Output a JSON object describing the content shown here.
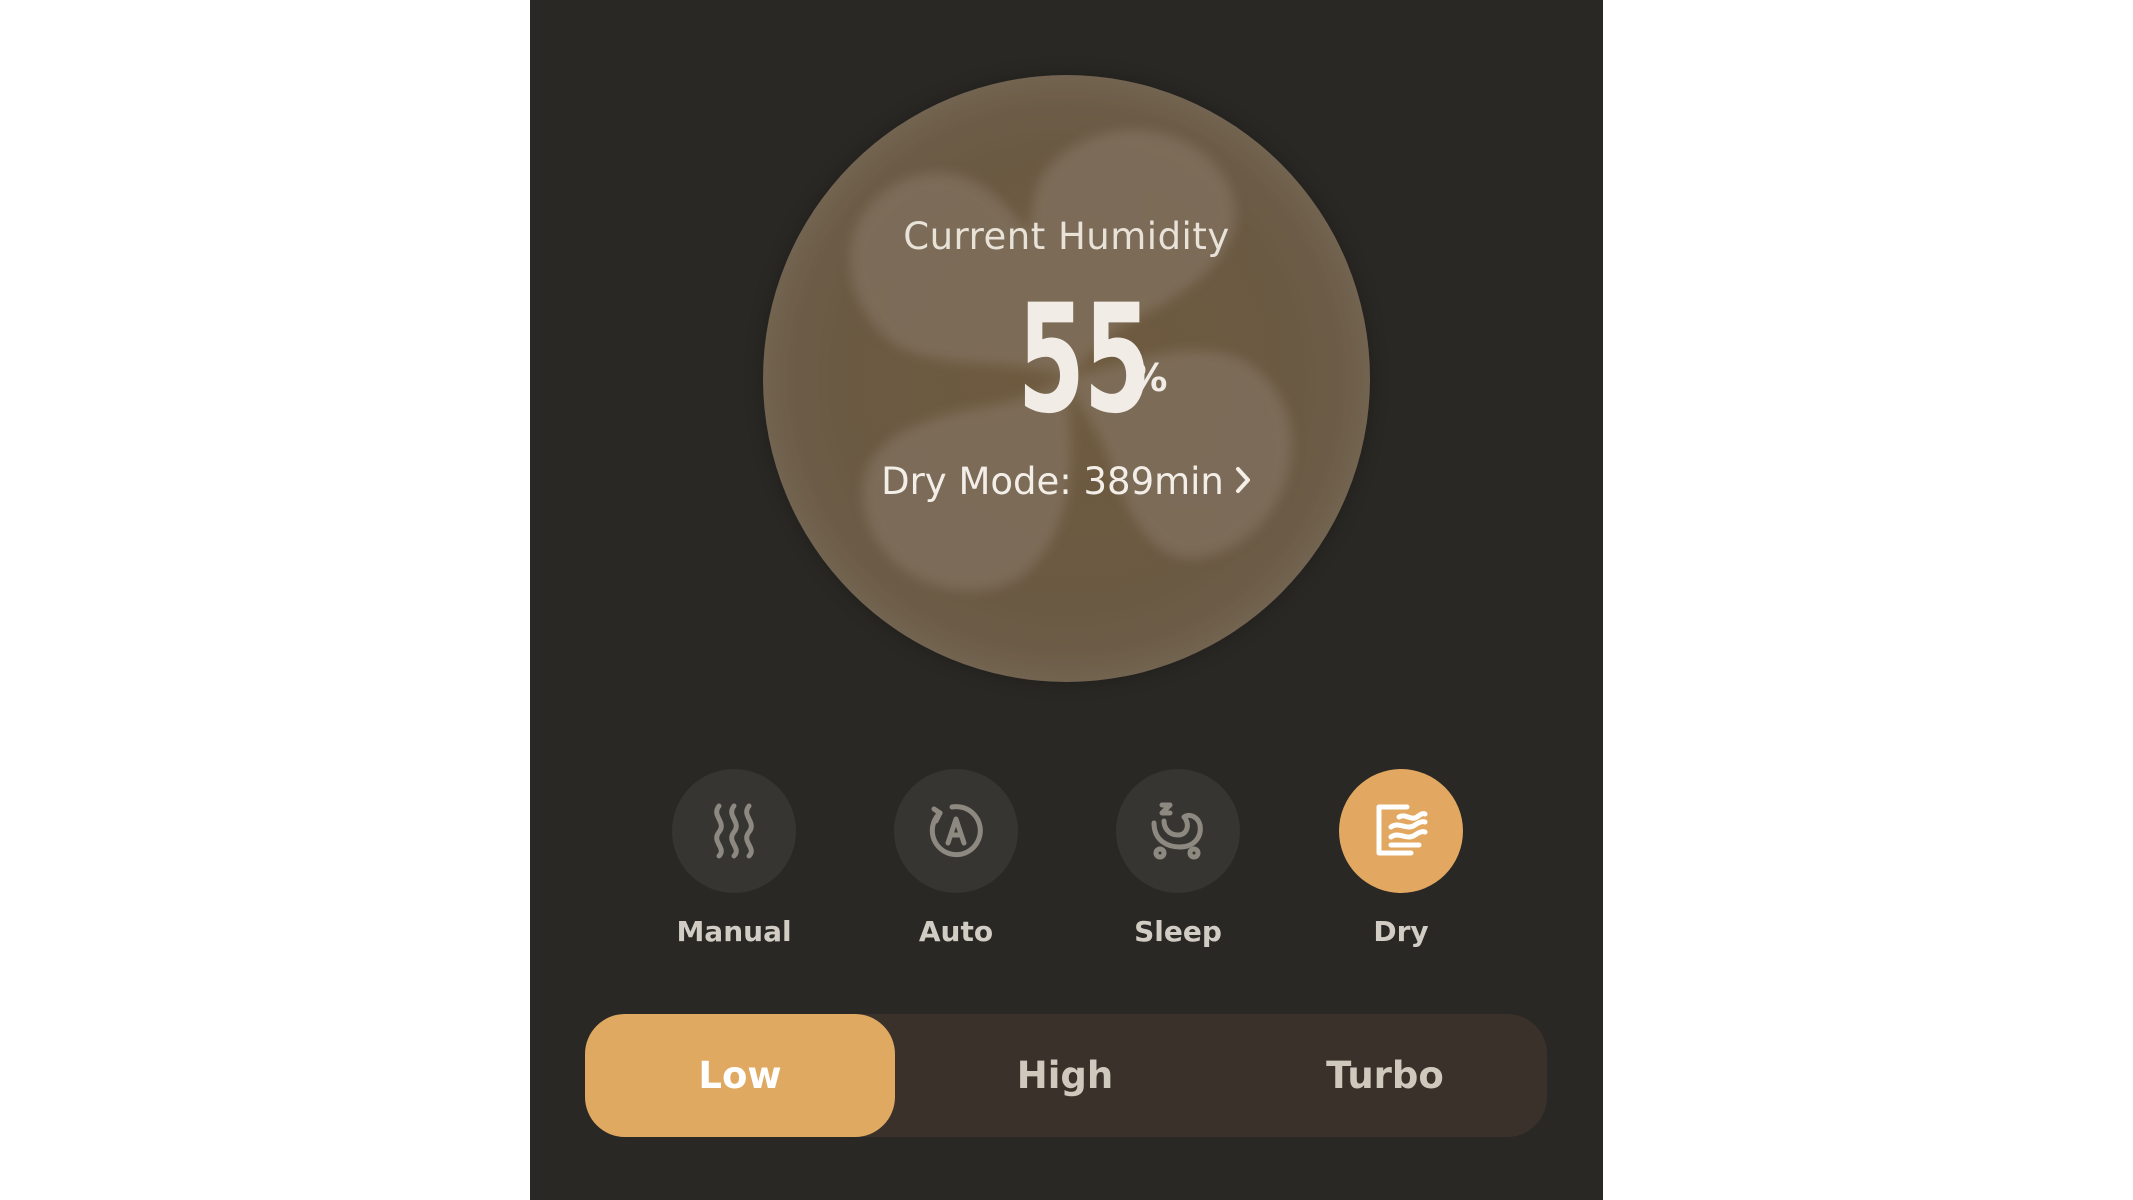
{
  "humidity": {
    "label": "Current Humidity",
    "value": "55",
    "unit": "%",
    "mode_status": "Dry Mode: 389min",
    "chevron": "›"
  },
  "modes": [
    {
      "label": "Manual",
      "icon": "steam-icon",
      "active": false
    },
    {
      "label": "Auto",
      "icon": "auto-mode-icon",
      "active": false
    },
    {
      "label": "Sleep",
      "icon": "sleep-icon",
      "active": false
    },
    {
      "label": "Dry",
      "icon": "dry-mode-icon",
      "active": true
    }
  ],
  "speed": {
    "options": [
      "Low",
      "High",
      "Turbo"
    ],
    "selected": "Low"
  },
  "colors": {
    "background": "#2a2824",
    "accent": "#e2a862",
    "mode_circle": "#373531",
    "speed_track": "#3a312a"
  }
}
